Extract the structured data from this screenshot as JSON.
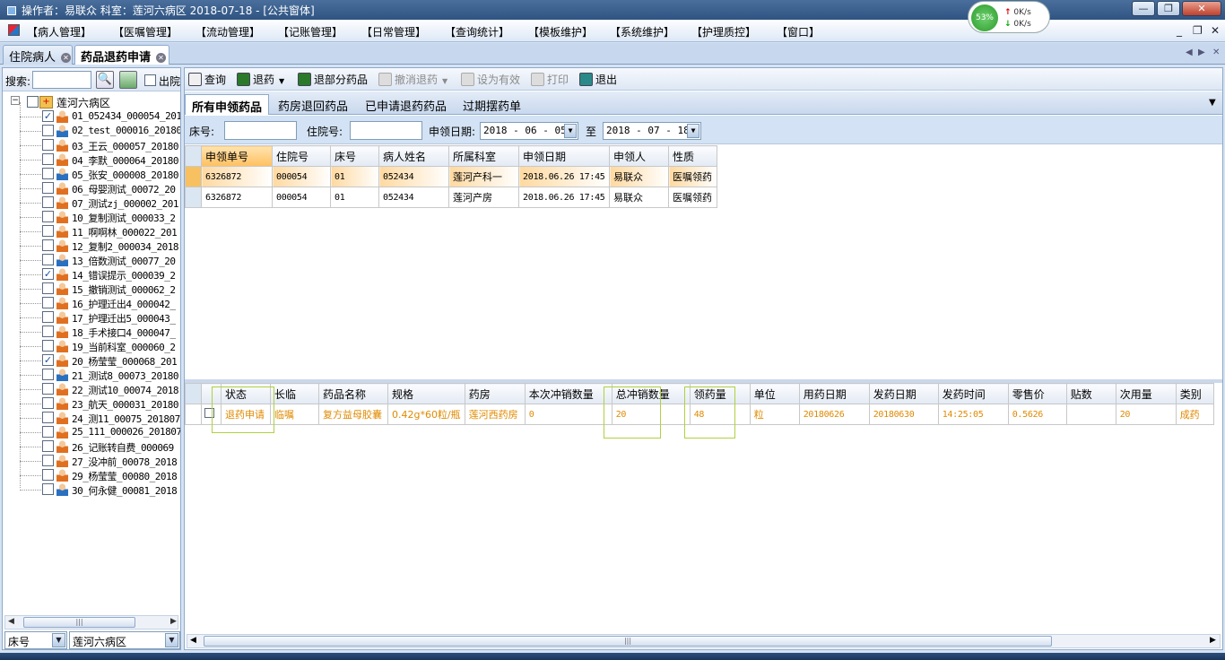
{
  "titlebar": {
    "text": "操作者：易联众  科室：莲河六病区  2018-07-18 - [公共窗体]",
    "min": "—",
    "max": "❐",
    "close": "✕"
  },
  "netmon": {
    "percent": "53%",
    "up": "0K/s",
    "down": "0K/s"
  },
  "menu": [
    "【病人管理】",
    "【医嘱管理】",
    "【流动管理】",
    "【记账管理】",
    "【日常管理】",
    "【查询统计】",
    "【模板维护】",
    "【系统维护】",
    "【护理质控】",
    "【窗口】"
  ],
  "mdi": {
    "min": "_",
    "restore": "❐",
    "close": "✕"
  },
  "doc_tabs": [
    {
      "label": "住院病人",
      "active": false
    },
    {
      "label": "药品退药申请",
      "active": true
    }
  ],
  "left": {
    "search_label": "搜索:",
    "discharged_label": "出院",
    "root": "莲河六病区",
    "patients": [
      {
        "label": "01_052434_000054_201",
        "checked": true,
        "gender": "f"
      },
      {
        "label": "02_test_000016_20180",
        "checked": false,
        "gender": "m"
      },
      {
        "label": "03_王云_000057_20180",
        "checked": false,
        "gender": "f"
      },
      {
        "label": "04_李默_000064_20180",
        "checked": false,
        "gender": "f"
      },
      {
        "label": "05_张安_000008_20180",
        "checked": false,
        "gender": "m"
      },
      {
        "label": "06_母婴测试_00072_20",
        "checked": false,
        "gender": "f"
      },
      {
        "label": "07_测试zj_000002_201",
        "checked": false,
        "gender": "f"
      },
      {
        "label": "10_复制测试_000033_2",
        "checked": false,
        "gender": "f"
      },
      {
        "label": "11_啊啊林_000022_201",
        "checked": false,
        "gender": "f"
      },
      {
        "label": "12_复制2_000034_2018",
        "checked": false,
        "gender": "f"
      },
      {
        "label": "13_倍数测试_00077_20",
        "checked": false,
        "gender": "m"
      },
      {
        "label": "14_错误提示_000039_2",
        "checked": true,
        "gender": "f"
      },
      {
        "label": "15_撤销测试_000062_2",
        "checked": false,
        "gender": "f"
      },
      {
        "label": "16_护理迁出4_000042_",
        "checked": false,
        "gender": "f"
      },
      {
        "label": "17_护理迁出5_000043_",
        "checked": false,
        "gender": "f"
      },
      {
        "label": "18_手术接口4_000047_",
        "checked": false,
        "gender": "f"
      },
      {
        "label": "19_当前科室_000060_2",
        "checked": false,
        "gender": "f"
      },
      {
        "label": "20_杨莹莹_000068_201",
        "checked": true,
        "gender": "f"
      },
      {
        "label": "21_测试8_00073_20180",
        "checked": false,
        "gender": "m"
      },
      {
        "label": "22_测试10_00074_2018",
        "checked": false,
        "gender": "f"
      },
      {
        "label": "23_航天_000031_20180",
        "checked": false,
        "gender": "f"
      },
      {
        "label": "24_测11_00075_201807",
        "checked": false,
        "gender": "f"
      },
      {
        "label": "25_111_000026_201807",
        "checked": false,
        "gender": "f"
      },
      {
        "label": "26_记账转自费_000069",
        "checked": false,
        "gender": "f"
      },
      {
        "label": "27_没冲前_00078_2018",
        "checked": false,
        "gender": "f"
      },
      {
        "label": "29_杨莹莹_00080_2018",
        "checked": false,
        "gender": "f"
      },
      {
        "label": "30_何永健_00081_2018",
        "checked": false,
        "gender": "m"
      }
    ],
    "scroll_grip": "|||",
    "bed_combo": "床号",
    "ward_combo": "莲河六病区"
  },
  "toolbar": [
    {
      "label": "查询",
      "icon": "search-icon",
      "enabled": true,
      "color": "#f0f0f0"
    },
    {
      "label": "退药",
      "icon": "return-icon",
      "enabled": true,
      "color": "#2a7a2a",
      "dropdown": true
    },
    {
      "label": "退部分药品",
      "icon": "partial-return-icon",
      "enabled": true,
      "color": "#2a7a2a"
    },
    {
      "label": "撤消退药",
      "icon": "undo-icon",
      "enabled": false,
      "color": "#ddd",
      "dropdown": true
    },
    {
      "label": "设为有效",
      "icon": "valid-icon",
      "enabled": false,
      "color": "#ddd"
    },
    {
      "label": "打印",
      "icon": "printer-icon",
      "enabled": false,
      "color": "#ddd"
    },
    {
      "label": "退出",
      "icon": "exit-icon",
      "enabled": true,
      "color": "#2a8a8a"
    }
  ],
  "tabs": [
    "所有申领药品",
    "药房退回药品",
    "已申请退药药品",
    "过期摆药单"
  ],
  "filters": {
    "bed_label": "床号:",
    "inpatient_label": "住院号:",
    "date_label": "申领日期:",
    "date_from": "2018 - 06 - 05",
    "to_label": "至",
    "date_to": "2018 - 07 - 18"
  },
  "upper_table": {
    "columns": [
      "申领单号",
      "住院号",
      "床号",
      "病人姓名",
      "所属科室",
      "申领日期",
      "申领人",
      "性质"
    ],
    "rows": [
      [
        "6326872",
        "000054",
        "01",
        "052434",
        "莲河产科一",
        "2018.06.26 17:45",
        "易联众",
        "医嘱领药"
      ],
      [
        "6326872",
        "000054",
        "01",
        "052434",
        "莲河产房",
        "2018.06.26 17:45",
        "易联众",
        "医嘱领药"
      ]
    ]
  },
  "lower_table": {
    "columns": [
      "状态",
      "长临",
      "药品名称",
      "规格",
      "药房",
      "本次冲销数量",
      "总冲销数量",
      "领药量",
      "单位",
      "用药日期",
      "发药日期",
      "发药时间",
      "零售价",
      "贴数",
      "次用量",
      "类别"
    ],
    "rows": [
      [
        "退药申请",
        "临嘱",
        "复方益母胶囊",
        "0.42g*60粒/瓶",
        "莲河西药房",
        "0",
        "20",
        "48",
        "粒",
        "20180626",
        "20180630",
        "14:25:05",
        "0.5626",
        "",
        "20",
        "成药"
      ]
    ]
  },
  "colors": {
    "accent": "#ffc060",
    "highlight_text": "#e08a00"
  }
}
